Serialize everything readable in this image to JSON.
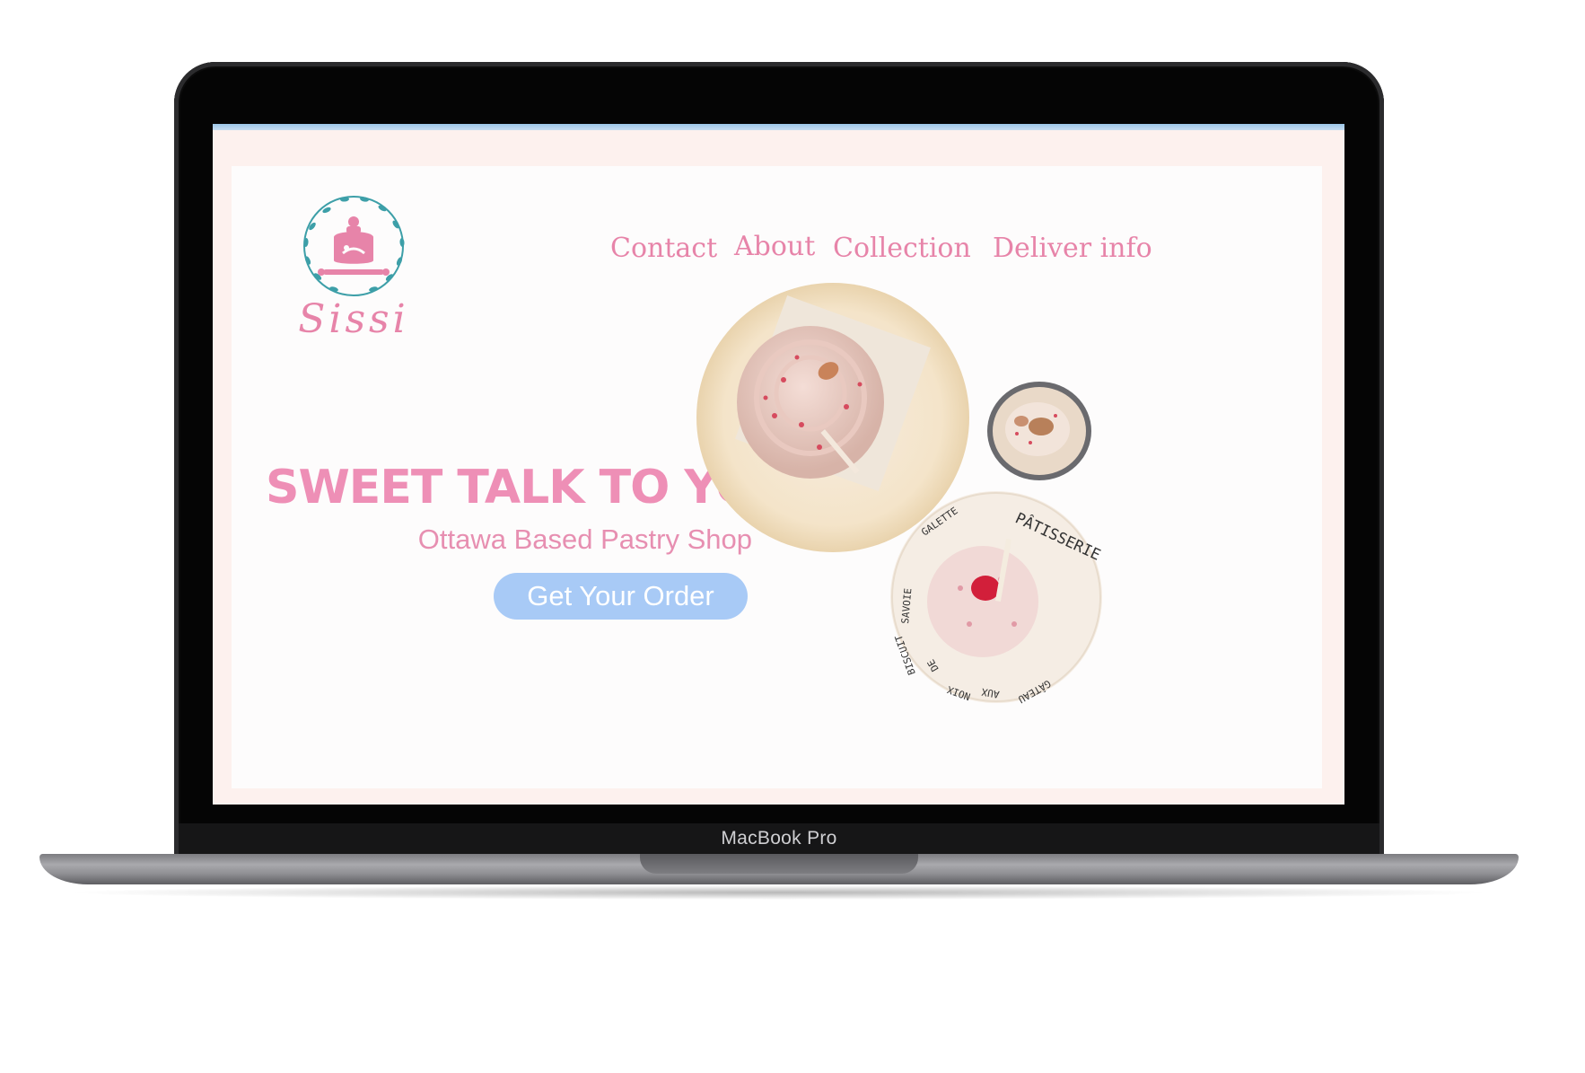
{
  "device": {
    "model_label": "MacBook Pro"
  },
  "site": {
    "logo_text": "Sissi",
    "nav": {
      "contact": "Contact",
      "about": "About",
      "collection": "Collection",
      "deliver_info": "Deliver info"
    },
    "hero": {
      "title": "SWEET TALK TO YOU",
      "subtitle": "Ottawa Based Pastry Shop",
      "cta_label": "Get Your Order"
    },
    "plate_text": {
      "patisserie": "PÂTISSERIE",
      "galette": "GALETTE",
      "savoie": "SAVOIE",
      "biscuit": "BISCUIT",
      "de": "DE",
      "noix": "NOIX",
      "aux": "AUX",
      "gateau": "GÂTEAU"
    }
  },
  "colors": {
    "accent_pink": "#e784a9",
    "title_pink": "#ee8fb6",
    "cta_blue": "#a8caf6",
    "logo_teal": "#3d9fa8",
    "screen_bg": "#fdf1ee"
  },
  "icons": [
    "cake-logo-icon",
    "laurel-wreath-icon"
  ]
}
